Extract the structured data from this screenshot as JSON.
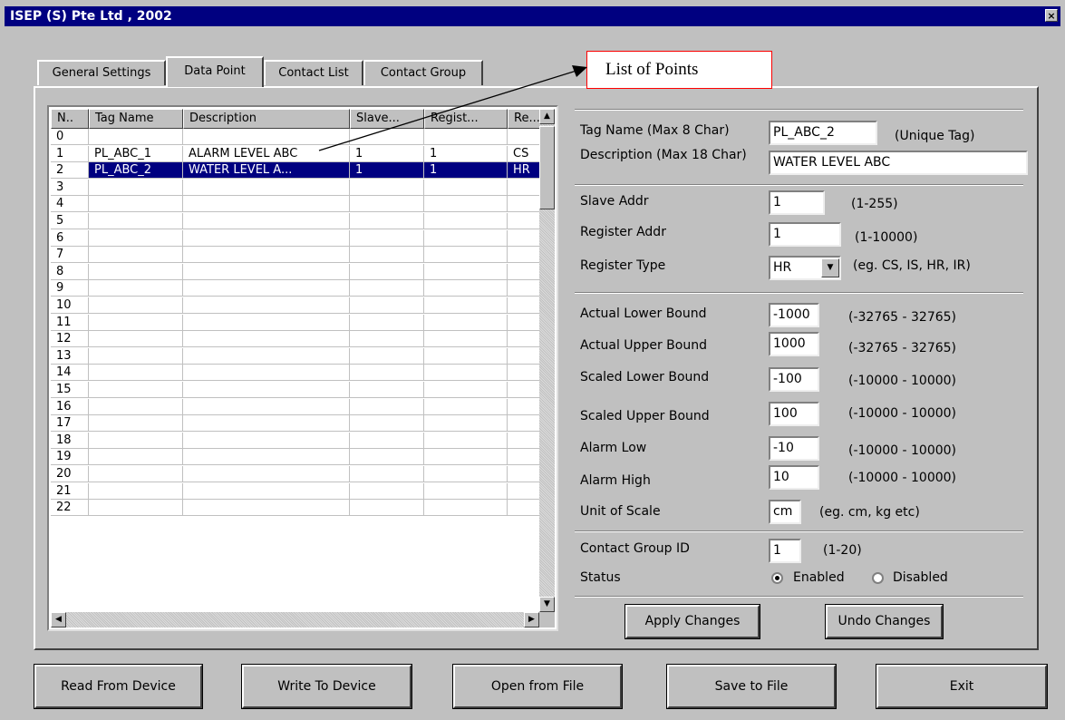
{
  "window": {
    "title": "ISEP (S) Pte Ltd , 2002",
    "close_glyph": "×"
  },
  "tabs": [
    {
      "label": "General Settings",
      "active": false
    },
    {
      "label": "Data Point",
      "active": true
    },
    {
      "label": "Contact List",
      "active": false
    },
    {
      "label": "Contact Group",
      "active": false
    }
  ],
  "annotation": {
    "text": "List of Points",
    "border_color": "#ff0000"
  },
  "grid": {
    "columns": [
      "N..",
      "Tag Name",
      "Description",
      "Slave...",
      "Regist...",
      "Re..."
    ],
    "rows": [
      [
        "0",
        "",
        "",
        "",
        "",
        ""
      ],
      [
        "1",
        "PL_ABC_1",
        "ALARM LEVEL ABC",
        "1",
        "1",
        "CS"
      ],
      [
        "2",
        "PL_ABC_2",
        "WATER LEVEL A...",
        "1",
        "1",
        "HR"
      ],
      [
        "3",
        "",
        "",
        "",
        "",
        ""
      ],
      [
        "4",
        "",
        "",
        "",
        "",
        ""
      ],
      [
        "5",
        "",
        "",
        "",
        "",
        ""
      ],
      [
        "6",
        "",
        "",
        "",
        "",
        ""
      ],
      [
        "7",
        "",
        "",
        "",
        "",
        ""
      ],
      [
        "8",
        "",
        "",
        "",
        "",
        ""
      ],
      [
        "9",
        "",
        "",
        "",
        "",
        ""
      ],
      [
        "10",
        "",
        "",
        "",
        "",
        ""
      ],
      [
        "11",
        "",
        "",
        "",
        "",
        ""
      ],
      [
        "12",
        "",
        "",
        "",
        "",
        ""
      ],
      [
        "13",
        "",
        "",
        "",
        "",
        ""
      ],
      [
        "14",
        "",
        "",
        "",
        "",
        ""
      ],
      [
        "15",
        "",
        "",
        "",
        "",
        ""
      ],
      [
        "16",
        "",
        "",
        "",
        "",
        ""
      ],
      [
        "17",
        "",
        "",
        "",
        "",
        ""
      ],
      [
        "18",
        "",
        "",
        "",
        "",
        ""
      ],
      [
        "19",
        "",
        "",
        "",
        "",
        ""
      ],
      [
        "20",
        "",
        "",
        "",
        "",
        ""
      ],
      [
        "21",
        "",
        "",
        "",
        "",
        ""
      ],
      [
        "22",
        "",
        "",
        "",
        "",
        ""
      ]
    ],
    "selected_row": 2,
    "selection_color": "#000080"
  },
  "form": {
    "tag_name": {
      "label": "Tag Name (Max 8 Char)",
      "value": "PL_ABC_2",
      "hint": "(Unique Tag)"
    },
    "description": {
      "label": "Description (Max 18 Char)",
      "value": "WATER LEVEL ABC"
    },
    "slave_addr": {
      "label": "Slave Addr",
      "value": "1",
      "hint": "(1-255)"
    },
    "register_addr": {
      "label": "Register Addr",
      "value": "1",
      "hint": "(1-10000)"
    },
    "register_type": {
      "label": "Register Type",
      "value": "HR",
      "hint": "(eg. CS, IS, HR, IR)"
    },
    "actual_lower": {
      "label": "Actual Lower Bound",
      "value": "-1000",
      "hint": "(-32765 - 32765)"
    },
    "actual_upper": {
      "label": "Actual Upper Bound",
      "value": "1000",
      "hint": "(-32765 - 32765)"
    },
    "scaled_lower": {
      "label": "Scaled Lower Bound",
      "value": "-100",
      "hint": "(-10000 - 10000)"
    },
    "scaled_upper": {
      "label": "Scaled Upper Bound",
      "value": "100",
      "hint": "(-10000 - 10000)"
    },
    "alarm_low": {
      "label": "Alarm Low",
      "value": "-10",
      "hint": "(-10000 - 10000)"
    },
    "alarm_high": {
      "label": "Alarm High",
      "value": "10",
      "hint": "(-10000 - 10000)"
    },
    "unit_of_scale": {
      "label": "Unit of Scale",
      "value": "cm",
      "hint": "(eg. cm, kg etc)"
    },
    "contact_group_id": {
      "label": "Contact Group ID",
      "value": "1",
      "hint": "(1-20)"
    },
    "status": {
      "label": "Status",
      "enabled_label": "Enabled",
      "disabled_label": "Disabled",
      "selected": "Enabled"
    }
  },
  "panel_buttons": {
    "apply": "Apply Changes",
    "undo": "Undo Changes"
  },
  "footer_buttons": {
    "read": "Read From Device",
    "write": "Write To Device",
    "open": "Open from File",
    "save": "Save to File",
    "exit": "Exit"
  },
  "icons": {
    "scroll_up": "▲",
    "scroll_down": "▼",
    "scroll_left": "◀",
    "scroll_right": "▶",
    "dropdown": "▼"
  }
}
